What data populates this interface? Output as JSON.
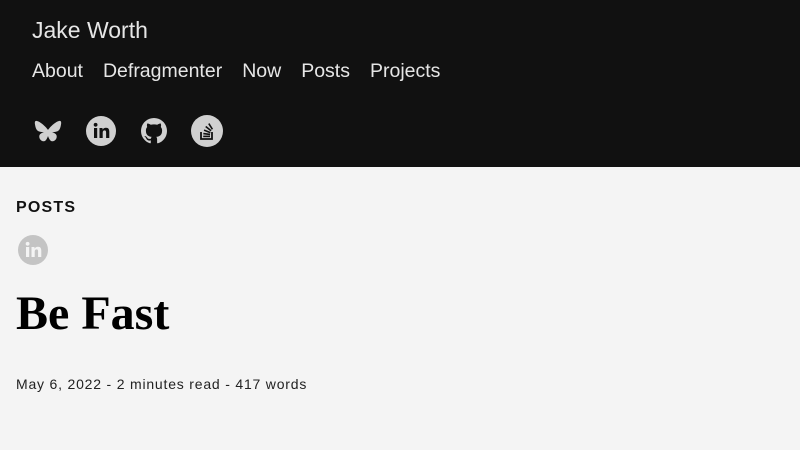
{
  "header": {
    "site_title": "Jake Worth",
    "nav": [
      {
        "label": "About"
      },
      {
        "label": "Defragmenter"
      },
      {
        "label": "Now"
      },
      {
        "label": "Posts"
      },
      {
        "label": "Projects"
      }
    ],
    "social_icons": [
      "bluesky-icon",
      "linkedin-icon",
      "github-icon",
      "stackoverflow-icon"
    ],
    "icon_color": "#cfcfcf",
    "background": "#111111"
  },
  "main": {
    "section_label": "POSTS",
    "share_icon": "linkedin-icon",
    "post_title": "Be Fast",
    "meta": {
      "date": "May 6, 2022",
      "separator1": " - ",
      "reading_time": "2 minutes read",
      "separator2": " - ",
      "word_count": "417 words"
    },
    "background": "#f4f4f4"
  }
}
